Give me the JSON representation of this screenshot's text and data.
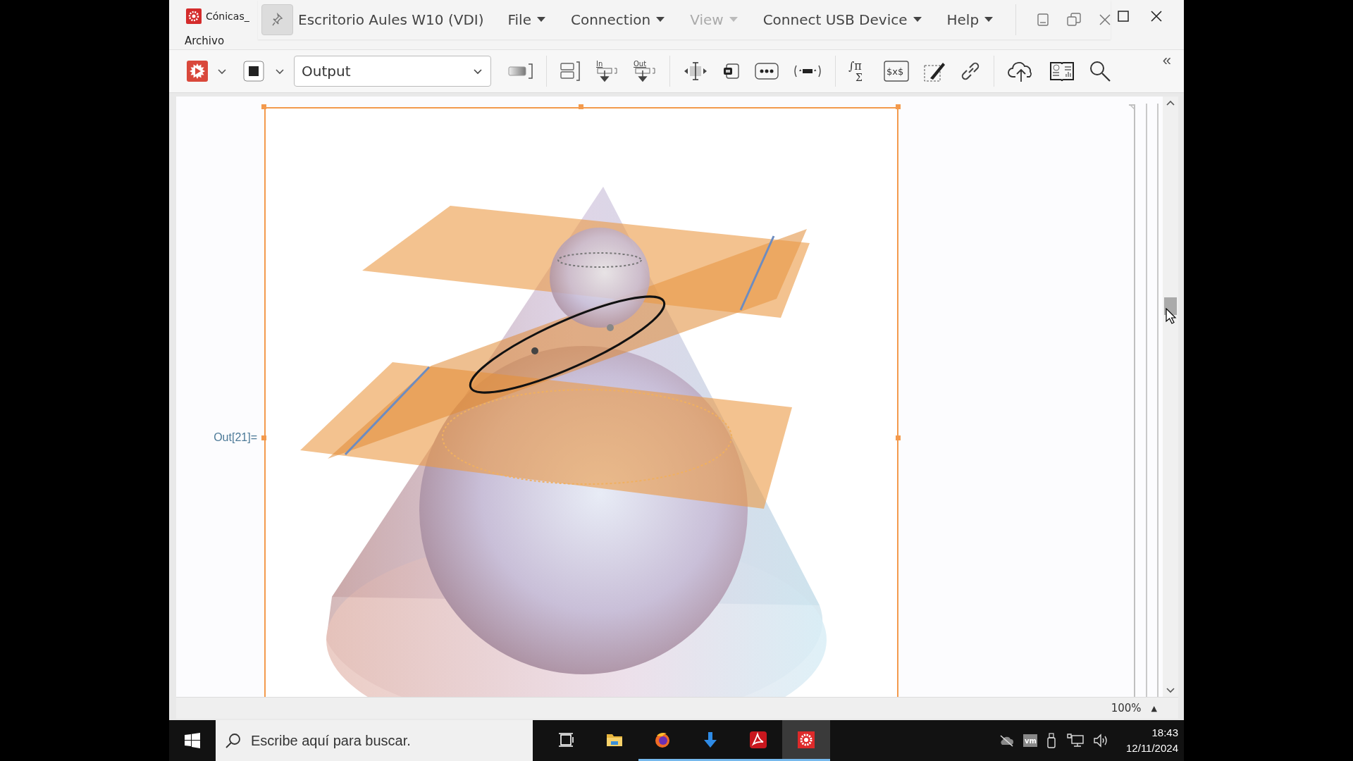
{
  "window": {
    "title": "Cónicas_",
    "menus": [
      "Archivo"
    ]
  },
  "vdi_bar": {
    "title": "Escritorio Aules W10 (VDI)",
    "menus": [
      {
        "label": "File",
        "disabled": false
      },
      {
        "label": "Connection",
        "disabled": false
      },
      {
        "label": "View",
        "disabled": true
      },
      {
        "label": "Connect USB Device",
        "disabled": false
      },
      {
        "label": "Help",
        "disabled": false
      }
    ]
  },
  "toolbar": {
    "style_value": "Output",
    "tools": [
      {
        "kind": "bracket"
      },
      {
        "kind": "group"
      },
      {
        "kind": "in",
        "labels": [
          "In"
        ]
      },
      {
        "kind": "out",
        "labels": [
          "Out"
        ]
      },
      {
        "kind": "resize"
      },
      {
        "kind": "frame"
      },
      {
        "kind": "ellipsis"
      },
      {
        "kind": "template"
      },
      {
        "kind": "math",
        "labels": [
          "∫π",
          "Σ"
        ]
      },
      {
        "kind": "dollar",
        "labels": [
          "$x$"
        ]
      },
      {
        "kind": "edit"
      },
      {
        "kind": "link"
      },
      {
        "kind": "cloud"
      },
      {
        "kind": "book"
      },
      {
        "kind": "search"
      }
    ],
    "collapse": "«"
  },
  "notebook": {
    "cell_label": "Out[21]="
  },
  "status_bar": {
    "zoom": "100%",
    "zoom_arrow": "▲"
  },
  "taskbar": {
    "search_placeholder": "Escribe aquí para buscar.",
    "apps": [
      {
        "kind": "task-view",
        "running": false,
        "selected": false
      },
      {
        "kind": "folder",
        "running": false,
        "selected": false
      },
      {
        "kind": "firefox",
        "running": true,
        "selected": false
      },
      {
        "kind": "download",
        "running": true,
        "selected": false
      },
      {
        "kind": "acrobat",
        "running": true,
        "selected": false
      },
      {
        "kind": "mathematica",
        "running": true,
        "selected": true
      }
    ],
    "tray_vm_label": "vm",
    "time": "18:43",
    "date": "12/11/2024"
  }
}
